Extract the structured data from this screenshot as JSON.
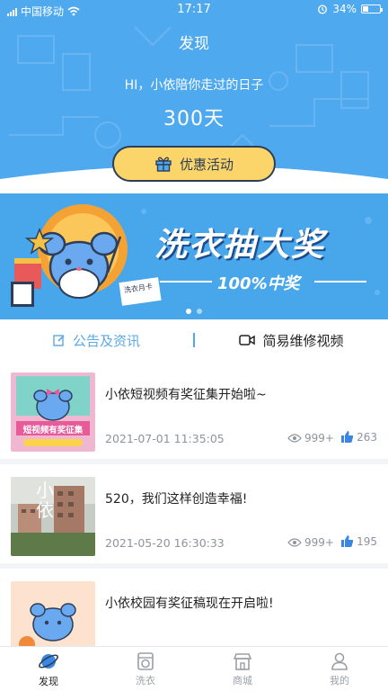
{
  "status_bar": {
    "carrier": "中国移动",
    "time": "17:17",
    "battery": "34%",
    "battery_level": 0.34
  },
  "header": {
    "title": "发现",
    "greeting": "HI，小依陪你走过的日子",
    "days": "300天",
    "promo_button": "优惠活动"
  },
  "banner": {
    "headline": "洗衣抽大奖",
    "subline": "100%中奖",
    "sign_text": "洗衣月卡",
    "slide_count": 2,
    "active_slide": 0
  },
  "tabs": [
    {
      "label": "公告及资讯",
      "active": false
    },
    {
      "label": "简易维修视频",
      "active": true
    }
  ],
  "news": [
    {
      "title": "小依短视频有奖征集开始啦~",
      "date": "2021-07-01 11:35:05",
      "views": "999+",
      "likes": "263",
      "thumb_text": "短视频有奖征集"
    },
    {
      "title": "520，我们这样创造幸福!",
      "date": "2021-05-20 16:30:33",
      "views": "999+",
      "likes": "195",
      "thumb_text": "小依"
    },
    {
      "title": "小依校园有奖征稿现在开启啦!",
      "date": "",
      "views": "",
      "likes": "",
      "thumb_text": ""
    }
  ],
  "bottom_nav": [
    {
      "label": "发现",
      "icon": "planet-icon",
      "active": true
    },
    {
      "label": "洗衣",
      "icon": "washer-icon",
      "active": false
    },
    {
      "label": "商城",
      "icon": "shop-icon",
      "active": false
    },
    {
      "label": "我的",
      "icon": "user-icon",
      "active": false
    }
  ],
  "colors": {
    "primary": "#4fa9ef",
    "promo_yellow": "#fcd56a",
    "dark_navy": "#2d3e58",
    "like_blue": "#3a86e0"
  }
}
